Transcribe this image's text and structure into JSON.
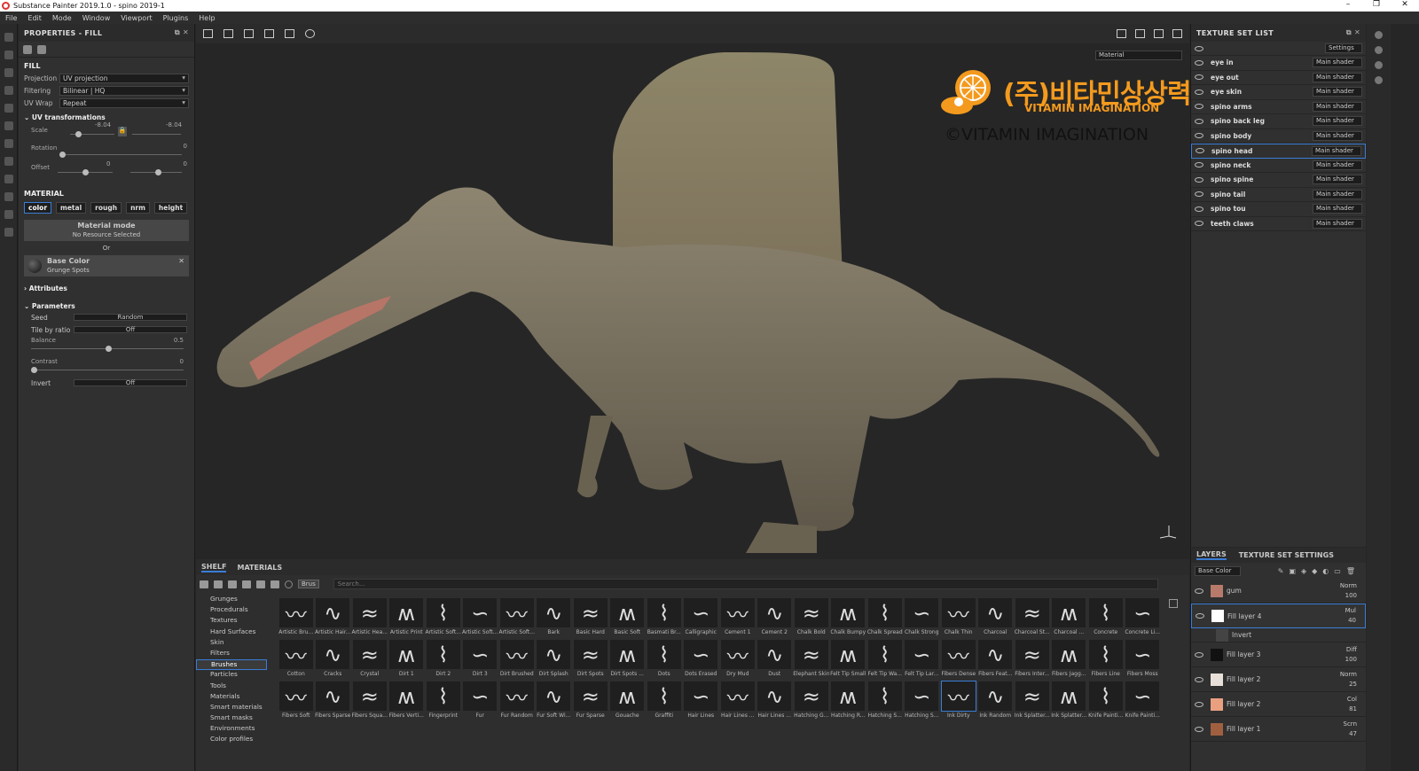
{
  "window": {
    "title": "Substance Painter 2019.1.0 - spino 2019-1",
    "controls": [
      "–",
      "❐",
      "✕"
    ]
  },
  "menu": [
    "File",
    "Edit",
    "Mode",
    "Window",
    "Viewport",
    "Plugins",
    "Help"
  ],
  "properties": {
    "title": "PROPERTIES - FILL",
    "fill_header": "FILL",
    "projection": {
      "label": "Projection",
      "value": "UV projection"
    },
    "filtering": {
      "label": "Filtering",
      "value": "Bilinear | HQ"
    },
    "uvwrap": {
      "label": "UV Wrap",
      "value": "Repeat"
    },
    "uv_transformations": "UV transformations",
    "scale": {
      "label": "Scale",
      "value": "-8.04",
      "value2": "-8.04"
    },
    "rotation": {
      "label": "Rotation",
      "value": "0"
    },
    "offset": {
      "label": "Offset",
      "value": "0",
      "value2": "0"
    },
    "material_header": "MATERIAL",
    "channels": [
      "color",
      "metal",
      "rough",
      "nrm",
      "height"
    ],
    "material_mode": "Material mode",
    "no_resource": "No Resource Selected",
    "or": "Or",
    "base_color": "Base Color",
    "grunge": "Grunge Spots",
    "attributes": "Attributes",
    "parameters": "Parameters",
    "seed": {
      "label": "Seed",
      "value": "Random"
    },
    "tile_by_ratio": {
      "label": "Tile by ratio",
      "value": "Off"
    },
    "balance": {
      "label": "Balance",
      "value": "0.5"
    },
    "contrast": {
      "label": "Contrast",
      "value": "0"
    },
    "invert": {
      "label": "Invert",
      "value": "Off"
    }
  },
  "viewport": {
    "material_dropdown": "Material"
  },
  "watermark": {
    "korean": "(주)비타민상상력",
    "english": "VITAMIN IMAGINATION",
    "copyright": "©VITAMIN IMAGINATION"
  },
  "texture_set_list": {
    "title": "TEXTURE SET LIST",
    "settings": "Settings",
    "rows": [
      {
        "name": "eye in",
        "shader": "Main shader"
      },
      {
        "name": "eye out",
        "shader": "Main shader"
      },
      {
        "name": "eye skin",
        "shader": "Main shader"
      },
      {
        "name": "spino arms",
        "shader": "Main shader"
      },
      {
        "name": "spino back leg",
        "shader": "Main shader"
      },
      {
        "name": "spino body",
        "shader": "Main shader"
      },
      {
        "name": "spino head",
        "shader": "Main shader"
      },
      {
        "name": "spino neck",
        "shader": "Main shader"
      },
      {
        "name": "spino spine",
        "shader": "Main shader"
      },
      {
        "name": "spino tail",
        "shader": "Main shader"
      },
      {
        "name": "spino tou",
        "shader": "Main shader"
      },
      {
        "name": "teeth claws",
        "shader": "Main shader"
      }
    ],
    "selected": "spino head"
  },
  "layers": {
    "tabs": [
      "LAYERS",
      "TEXTURE SET SETTINGS"
    ],
    "channel": "Base Color",
    "rows": [
      {
        "name": "gum",
        "mode": "Norm",
        "opacity": "100",
        "thumb": "#b87a6a"
      },
      {
        "name": "Fill layer 4",
        "mode": "Mul",
        "opacity": "40",
        "thumb": "#ffffff"
      },
      {
        "name": "Invert",
        "mode": "",
        "opacity": "",
        "thumb": "#444444"
      },
      {
        "name": "Fill layer 3",
        "mode": "Diff",
        "opacity": "100",
        "thumb": "#111111"
      },
      {
        "name": "Fill layer 2",
        "mode": "Norm",
        "opacity": "25",
        "thumb": "#e8e0d8"
      },
      {
        "name": "Fill layer 2",
        "mode": "Col",
        "opacity": "81",
        "thumb": "#e8a080"
      },
      {
        "name": "Fill layer 1",
        "mode": "Scrn",
        "opacity": "47",
        "thumb": "#a06040"
      }
    ]
  },
  "shelf": {
    "tabs": [
      "SHELF",
      "MATERIALS"
    ],
    "filter_chip": "Brus",
    "search_placeholder": "Search...",
    "categories": [
      "Grunges",
      "Procedurals",
      "Textures",
      "Hard Surfaces",
      "Skin",
      "Filters",
      "Brushes",
      "Particles",
      "Tools",
      "Materials",
      "Smart materials",
      "Smart masks",
      "Environments",
      "Color profiles"
    ],
    "selected_category": "Brushes",
    "items": [
      "Artistic Bru...",
      "Artistic Hair...",
      "Artistic Hea...",
      "Artistic Print",
      "Artistic Soft...",
      "Artistic Soft...",
      "Artistic Soft...",
      "Bark",
      "Basic Hard",
      "Basic Soft",
      "Basmati Br...",
      "Calligraphic",
      "Cement 1",
      "Cement 2",
      "Chalk Bold",
      "Chalk Bumpy",
      "Chalk Spread",
      "Chalk Strong",
      "Chalk Thin",
      "Charcoal",
      "Charcoal St...",
      "Charcoal ...",
      "Concrete",
      "Concrete Li...",
      "Cotton",
      "Cracks",
      "Crystal",
      "Dirt 1",
      "Dirt 2",
      "Dirt 3",
      "Dirt Brushed",
      "Dirt Splash",
      "Dirt Spots",
      "Dirt Spots ...",
      "Dots",
      "Dots Erased",
      "Dry Mud",
      "Dust",
      "Elephant Skin",
      "Felt Tip Small",
      "Felt Tip Wa...",
      "Felt Tip Lar...",
      "Fibers Dense",
      "Fibers Feat...",
      "Fibers Inter...",
      "Fibers Jagg...",
      "Fibers Line",
      "Fibers Moss",
      "Fibers Soft",
      "Fibers Sparse",
      "Fibers Squa...",
      "Fibers Verti...",
      "Fingerprint",
      "Fur",
      "Fur Random",
      "Fur Soft Wi...",
      "Fur Sparse",
      "Gouache",
      "Graffiti",
      "Hair Lines",
      "Hair Lines ...",
      "Hair Lines ...",
      "Hatching G...",
      "Hatching R...",
      "Hatching S...",
      "Hatching S...",
      "Ink Dirty",
      "Ink Random",
      "Ink Splatter...",
      "Ink Splatter...",
      "Knife Painti...",
      "Knife Painti..."
    ],
    "selected_item": "Ink Dirty"
  }
}
